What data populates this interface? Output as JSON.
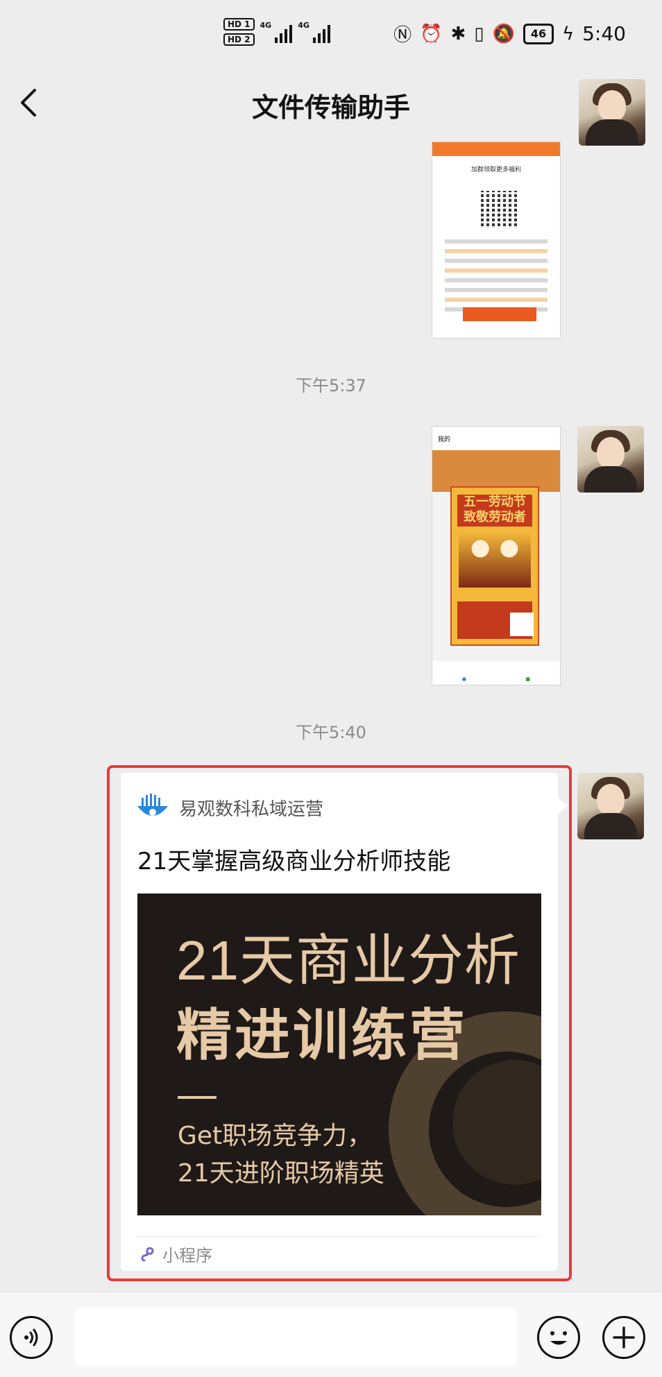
{
  "status_bar": {
    "hd1": "HD 1",
    "hd2": "HD 2",
    "sig1_label": "4G",
    "sig2_label": "4G",
    "battery": "46",
    "time": "5:40"
  },
  "header": {
    "title": "文件传输助手"
  },
  "messages": {
    "timestamp_1": "下午5:37",
    "timestamp_2": "下午5:40"
  },
  "thumb1": {
    "caption": "加群领取更多福利"
  },
  "thumb2": {
    "nav": "我的",
    "poster_title": "五一劳动节 致敬劳动者"
  },
  "mini_program": {
    "brand": "易观数科私域运营",
    "title": "21天掌握高级商业分析师技能",
    "banner_line1": "21天商业分析",
    "banner_line2": "精进训练营",
    "banner_sub1": "Get职场竞争力，",
    "banner_sub2": "21天进阶职场精英",
    "footer": "小程序"
  },
  "colors": {
    "highlight_border": "#e83a3a",
    "banner_bg": "#1f1a17",
    "banner_text": "#e6c9a6",
    "brand_logo": "#2a86d8"
  }
}
